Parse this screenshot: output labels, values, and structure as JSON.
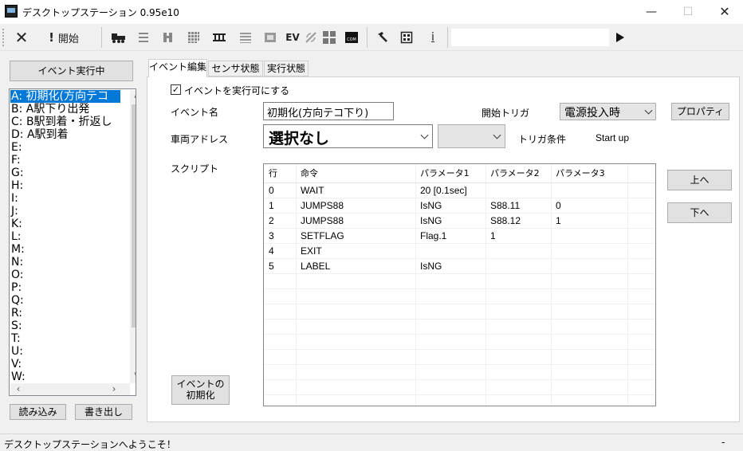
{
  "window": {
    "title": "デスクトップステーション 0.95e10"
  },
  "toolbar": {
    "start_label": "開始",
    "ev_label": "EV",
    "info_label": "i"
  },
  "left": {
    "run_button": "イベント実行中",
    "events": [
      "A: 初期化(方向テコ",
      "B: A駅下り出発",
      "C: B駅到着・折返し",
      "D: A駅到着",
      "E:",
      "F:",
      "G:",
      "H:",
      "I:",
      "J:",
      "K:",
      "L:",
      "M:",
      "N:",
      "O:",
      "P:",
      "Q:",
      "R:",
      "S:",
      "T:",
      "U:",
      "V:",
      "W:"
    ],
    "load_button": "読み込み",
    "save_button": "書き出し"
  },
  "tabs": [
    "イベント編集",
    "センサ状態",
    "実行状態"
  ],
  "editor": {
    "enable_label": "イベントを実行可にする",
    "event_name_label": "イベント名",
    "event_name_value": "初期化(方向テコ下り)",
    "start_trigger_label": "開始トリガ",
    "start_trigger_value": "電源投入時",
    "property_button": "プロパティ",
    "vehicle_address_label": "車両アドレス",
    "vehicle_address_value": "選択なし",
    "trigger_condition_label": "トリガ条件",
    "trigger_condition_value": "Start up",
    "script_label": "スクリプト",
    "up_button": "上へ",
    "down_button": "下へ",
    "init_button_line1": "イベントの",
    "init_button_line2": "初期化"
  },
  "script": {
    "headers": [
      "行",
      "命令",
      "パラメータ1",
      "パラメータ2",
      "パラメータ3"
    ],
    "rows": [
      [
        "0",
        "WAIT",
        "20 [0.1sec]",
        "",
        ""
      ],
      [
        "1",
        "JUMPS88",
        "IsNG",
        "S88.11",
        "0"
      ],
      [
        "2",
        "JUMPS88",
        "IsNG",
        "S88.12",
        "1"
      ],
      [
        "3",
        "SETFLAG",
        "Flag.1",
        "1",
        ""
      ],
      [
        "4",
        "EXIT",
        "",
        "",
        ""
      ],
      [
        "5",
        "LABEL",
        "IsNG",
        "",
        ""
      ]
    ]
  },
  "status": {
    "message": "デスクトップステーションへようこそ！",
    "right": "-"
  }
}
